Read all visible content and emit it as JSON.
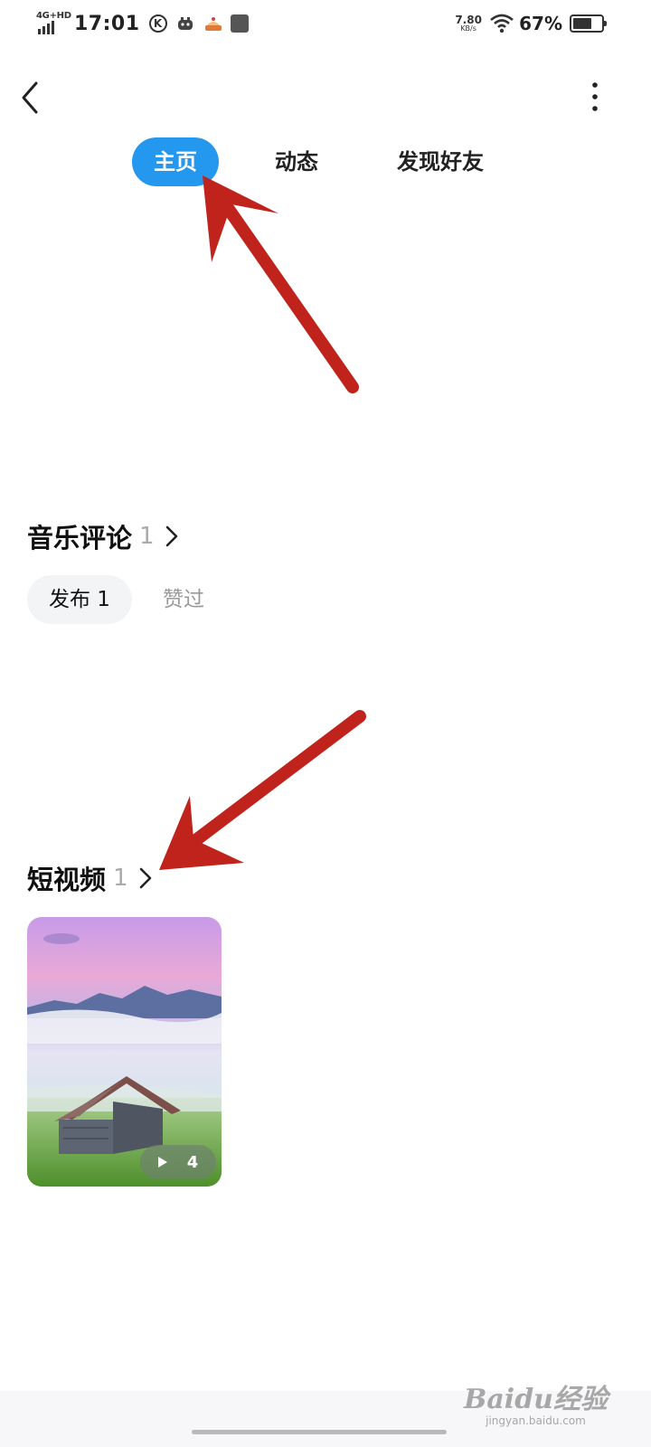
{
  "status_bar": {
    "network": "4G+HD",
    "time": "17:01",
    "k_badge": "K",
    "speed_value": "7.80",
    "speed_unit": "KB/s",
    "battery_percent": "67%",
    "battery_level": 0.67,
    "icons": [
      "signal-icon",
      "k-badge-icon",
      "robot-app-icon",
      "cake-app-icon",
      "app-square-icon",
      "wifi-icon",
      "battery-icon"
    ]
  },
  "nav": {
    "back_icon": "chevron-left-icon",
    "more_icon": "more-vertical-icon",
    "tabs": [
      {
        "label": "主页",
        "active": true
      },
      {
        "label": "动态",
        "active": false
      },
      {
        "label": "发现好友",
        "active": false
      }
    ],
    "active_color": "#2498ef"
  },
  "music_comments": {
    "title": "音乐评论",
    "count": "1",
    "subtabs": [
      {
        "label": "发布 1",
        "active": true
      },
      {
        "label": "赞过",
        "active": false
      }
    ]
  },
  "short_videos": {
    "title": "短视频",
    "count": "1",
    "items": [
      {
        "play_count": "4",
        "scene": "misty-mountain-cabin"
      }
    ]
  },
  "annotation_color": "#c0231b",
  "watermark": {
    "brand": "Baidu经验",
    "url": "jingyan.baidu.com"
  }
}
